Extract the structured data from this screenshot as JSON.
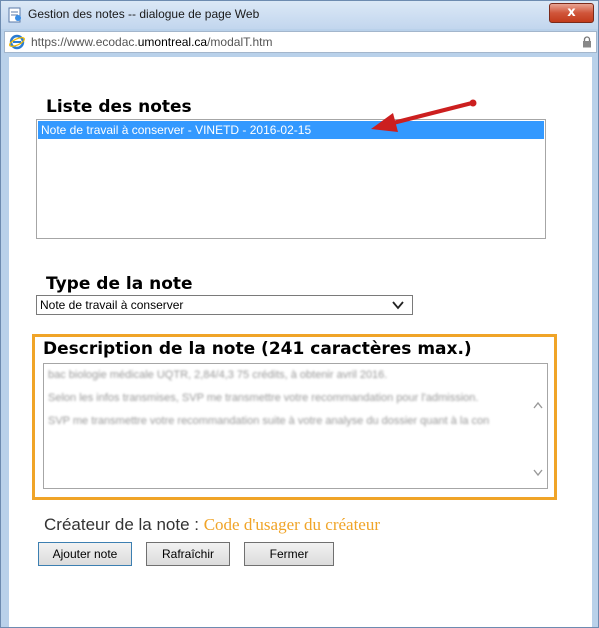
{
  "window": {
    "title": "Gestion des notes -- dialogue de page Web",
    "close_label": "x"
  },
  "address": {
    "prefix": "https://www.ecodac.",
    "domain": "umontreal.ca",
    "suffix": "/modalT.htm"
  },
  "notes_list": {
    "title": "Liste des notes",
    "items": [
      "Note de travail à conserver - VINETD - 2016-02-15"
    ]
  },
  "note_type": {
    "title": "Type de la note",
    "selected": "Note de travail à conserver"
  },
  "description": {
    "title": "Description de la note (241 caractères max.)",
    "paragraphs": [
      "bac biologie médicale UQTR, 2,84/4,3 75 crédits, à obtenir avril 2016.",
      "Selon les infos transmises, SVP me transmettre votre recommandation pour l'admission.",
      "SVP me transmettre votre recommandation suite à votre analyse du dossier quant à la con"
    ]
  },
  "creator": {
    "label": "Créateur de la note :",
    "value": "Code d'usager du créateur"
  },
  "buttons": {
    "add": "Ajouter note",
    "refresh": "Rafraîchir",
    "close": "Fermer"
  },
  "colors": {
    "selection": "#3399ff",
    "highlight_frame": "#f0a428",
    "arrow": "#cc1f1f"
  }
}
